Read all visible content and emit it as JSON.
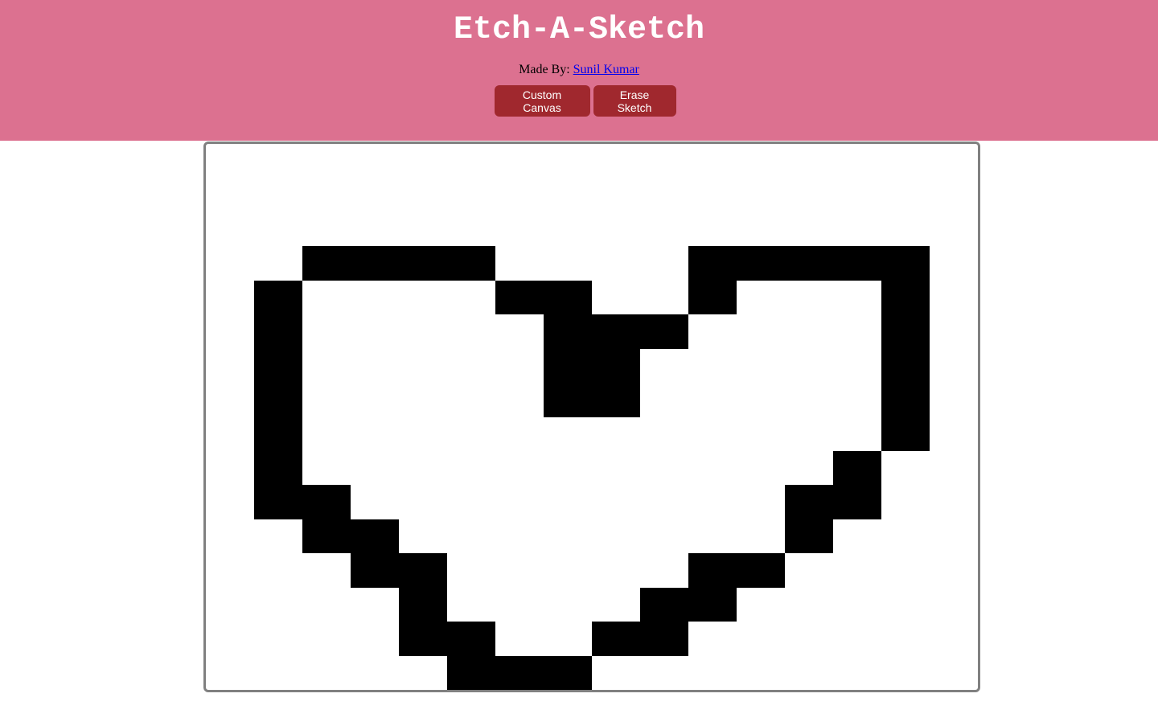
{
  "header": {
    "title": "Etch-A-Sketch",
    "made_by_label": "Made By:",
    "author_name": "Sunil Kumar",
    "bg_color": "#dc7190"
  },
  "buttons": {
    "custom_canvas_label": "Custom Canvas",
    "erase_sketch_label": "Erase Sketch",
    "color": "#a0282e"
  },
  "canvas": {
    "grid_size": 16,
    "ink_color": "#000000",
    "filled_cells": [
      [
        3,
        2
      ],
      [
        3,
        3
      ],
      [
        3,
        4
      ],
      [
        3,
        5
      ],
      [
        3,
        10
      ],
      [
        3,
        11
      ],
      [
        3,
        12
      ],
      [
        3,
        13
      ],
      [
        3,
        14
      ],
      [
        4,
        1
      ],
      [
        4,
        6
      ],
      [
        4,
        7
      ],
      [
        4,
        10
      ],
      [
        4,
        14
      ],
      [
        5,
        1
      ],
      [
        5,
        7
      ],
      [
        5,
        8
      ],
      [
        5,
        9
      ],
      [
        5,
        14
      ],
      [
        6,
        1
      ],
      [
        6,
        7
      ],
      [
        6,
        8
      ],
      [
        6,
        14
      ],
      [
        7,
        1
      ],
      [
        7,
        7
      ],
      [
        7,
        8
      ],
      [
        7,
        14
      ],
      [
        8,
        1
      ],
      [
        8,
        14
      ],
      [
        9,
        1
      ],
      [
        9,
        13
      ],
      [
        10,
        1
      ],
      [
        10,
        2
      ],
      [
        10,
        12
      ],
      [
        10,
        13
      ],
      [
        11,
        2
      ],
      [
        11,
        3
      ],
      [
        11,
        12
      ],
      [
        12,
        3
      ],
      [
        12,
        4
      ],
      [
        12,
        10
      ],
      [
        12,
        11
      ],
      [
        13,
        4
      ],
      [
        13,
        9
      ],
      [
        13,
        10
      ],
      [
        14,
        4
      ],
      [
        14,
        5
      ],
      [
        14,
        8
      ],
      [
        14,
        9
      ],
      [
        15,
        5
      ],
      [
        15,
        6
      ],
      [
        15,
        7
      ]
    ]
  }
}
